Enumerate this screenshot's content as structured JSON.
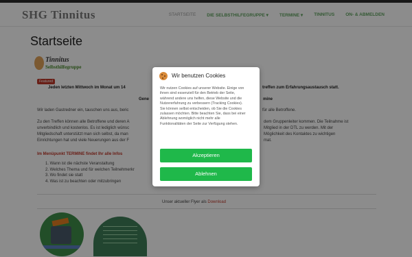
{
  "header": {
    "brand": "SHG Tinnitus",
    "nav": [
      {
        "label": "STARTSEITE"
      },
      {
        "label": "DIE SELBSTHILFEGRUPPE ▾"
      },
      {
        "label": "TERMINE ▾"
      },
      {
        "label": "TINNITUS"
      },
      {
        "label": "ON- & ABMELDEN"
      }
    ]
  },
  "page": {
    "title": "Startseite",
    "logo_line1": "Tinnitus",
    "logo_line2": "Selbsthilfegruppe",
    "featured_badge": "Featured",
    "p_meeting_left": "Jeden letzten Mittwoch im Monat um 14",
    "p_meeting_right": "treffen zum Erfahrungsaustausch statt.",
    "p_gene_left": "Gene",
    "p_gene_right": "mine",
    "p_guests_left": "Wir laden Gastredner ein, tauschen uns aus, beric",
    "p_guests_right": "für alle Betroffene.",
    "p_meet1_left": "Zu den Treffen können alle Betroffene und deren A",
    "p_meet1_right": "dem Gruppenleiter kommen. Die Teilnahme ist",
    "p_meet2_left": "unverbindlich und kostenlos. Es ist lediglich wünsc",
    "p_meet2_right": "Mitglied in der DTL zu werden. Mit der",
    "p_meet3_left": "Mitgliedschaft unterstützt man sich selbst, da man",
    "p_meet3_right": "Möglichkeit des Kontaktes zu wichtigen",
    "p_meet4_left": "Einrichtungen hat und viele Neuerungen aus der F",
    "p_meet4_right": "mat.",
    "menu_note": "Im Menüpunkt TERMINE findet Ihr alle Infos",
    "list_items": [
      "1. Wann ist die nächste Veranstaltung",
      "2. Welches Thema und für welchen Teilnehmerkr",
      "3. Wo findet sie statt",
      "4. Was ist zu beachten oder mitzubringen"
    ],
    "flyer_prefix": "Unser aktueller Flyer als",
    "flyer_link": "Download"
  },
  "cookie_dialog": {
    "title": "Wir benutzen Cookies",
    "body": "Wir nutzen Cookies auf unserer Website. Einige von ihnen sind essenziell für den Betrieb der Seite, während andere uns helfen, diese Website und die Nutzererfahrung zu verbessern (Tracking Cookies). Sie können selbst entscheiden, ob Sie die Cookies zulassen möchten. Bitte beachten Sie, dass bei einer Ablehnung womöglich nicht mehr alle Funktionalitäten der Seite zur Verfügung stehen.",
    "accept_label": "Akzeptieren",
    "decline_label": "Ablehnen"
  },
  "colors": {
    "accent_green": "#1fb84a",
    "nav_green": "#5fa35f",
    "link_red": "#c0392b"
  }
}
